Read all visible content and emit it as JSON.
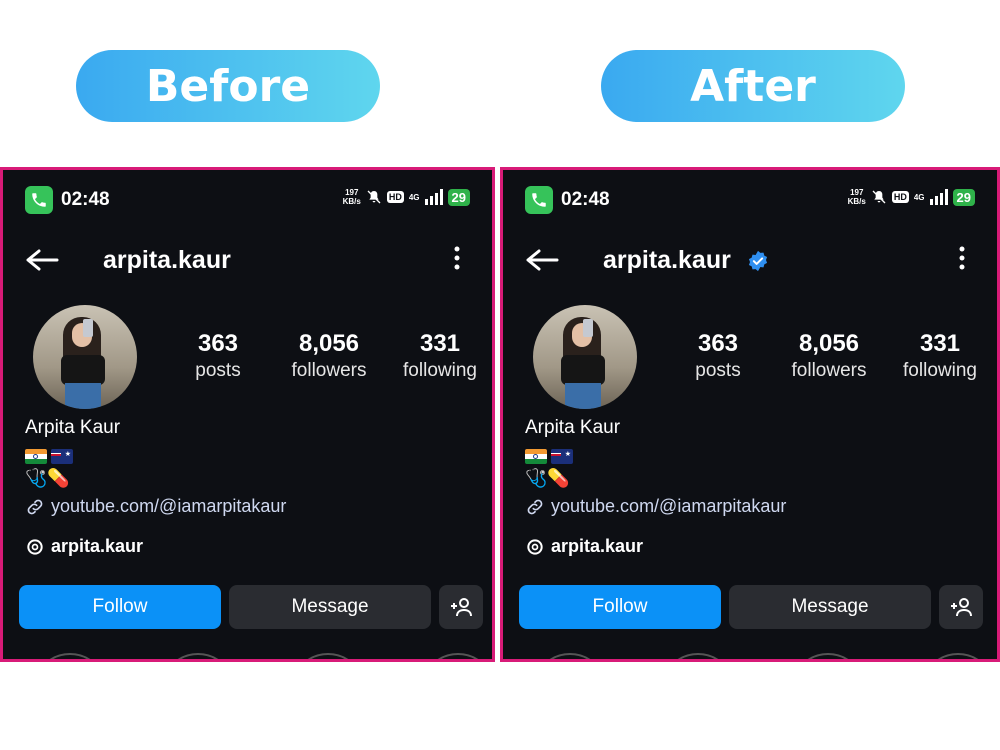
{
  "labels": {
    "before": "Before",
    "after": "After"
  },
  "colors": {
    "panel_border": "#d81b78",
    "follow_bg": "#0b91f7",
    "verified": "#2f8ff0",
    "battery": "#2fb24a"
  },
  "icons": [
    "phone-call-icon",
    "mute-icon",
    "signal-bars-icon",
    "back-arrow-icon",
    "more-vert-icon",
    "verified-badge-icon",
    "link-icon",
    "threads-icon",
    "add-user-icon"
  ],
  "status_bar": {
    "time": "02:48",
    "speed_value": "197",
    "speed_unit": "KB/s",
    "hd": "HD",
    "network": "4G",
    "battery": "29"
  },
  "profile": {
    "username": "arpita.kaur",
    "display_name": "Arpita Kaur",
    "emoji_line": "🩺💊",
    "link": "youtube.com/@iamarpitakaur",
    "threads_handle": "arpita.kaur",
    "stats": [
      {
        "value": "363",
        "label": "posts"
      },
      {
        "value": "8,056",
        "label": "followers"
      },
      {
        "value": "331",
        "label": "following"
      }
    ]
  },
  "buttons": {
    "follow": "Follow",
    "message": "Message"
  }
}
